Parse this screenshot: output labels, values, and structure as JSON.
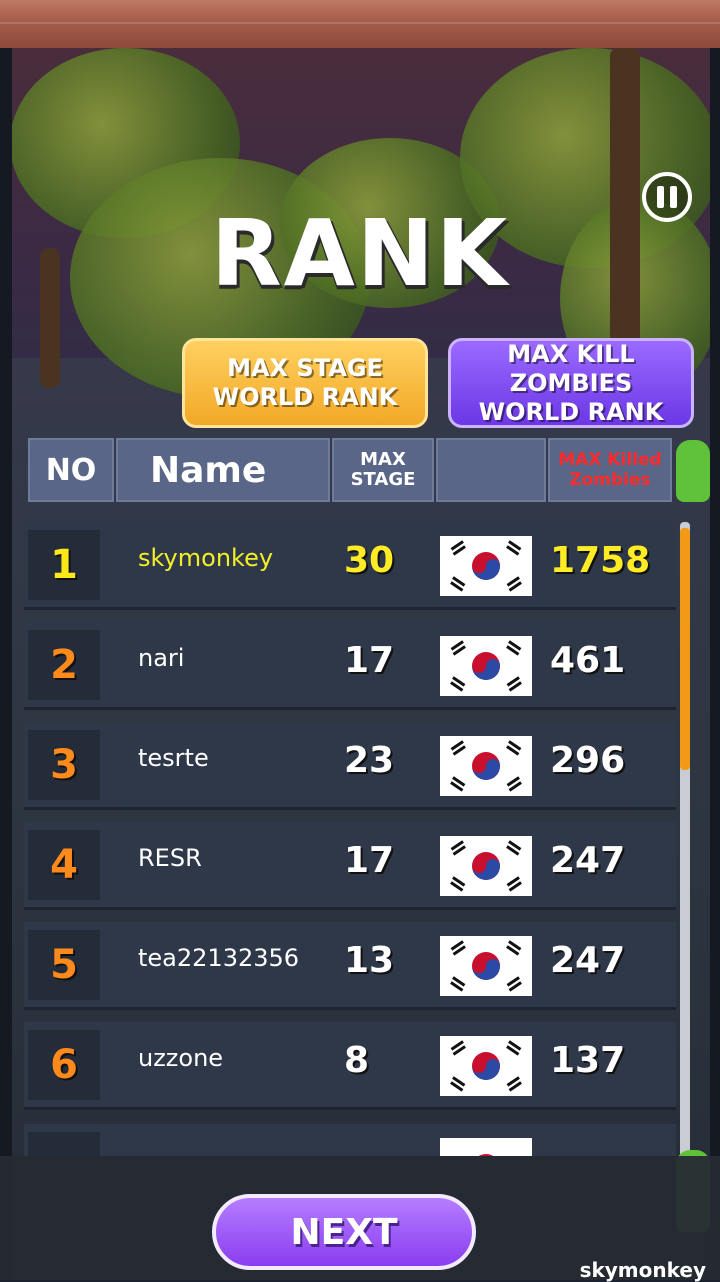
{
  "title": "RANK",
  "tabs": {
    "stage": {
      "line1": "MAX STAGE",
      "line2": "WORLD RANK"
    },
    "kill": {
      "line1": "MAX KILL ZOMBIES",
      "line2": "WORLD RANK"
    }
  },
  "headers": {
    "no": "NO",
    "name": "Name",
    "stage_line1": "MAX",
    "stage_line2": "STAGE",
    "kill_line1": "MAX Killed",
    "kill_line2": "Zombies"
  },
  "rows": [
    {
      "rank": "1",
      "name": "skymonkey",
      "stage": "30",
      "kills": "1758"
    },
    {
      "rank": "2",
      "name": "nari",
      "stage": "17",
      "kills": "461"
    },
    {
      "rank": "3",
      "name": "tesrte",
      "stage": "23",
      "kills": "296"
    },
    {
      "rank": "4",
      "name": "RESR",
      "stage": "17",
      "kills": "247"
    },
    {
      "rank": "5",
      "name": "tea22132356",
      "stage": "13",
      "kills": "247"
    },
    {
      "rank": "6",
      "name": "uzzone",
      "stage": "8",
      "kills": "137"
    }
  ],
  "next_label": "NEXT",
  "footer_username": "skymonkey",
  "colors": {
    "top_rank": "#ffe81a",
    "rank": "#ff8a1c",
    "kill_header": "#ff2a2a",
    "scroll": "#f29a18"
  }
}
